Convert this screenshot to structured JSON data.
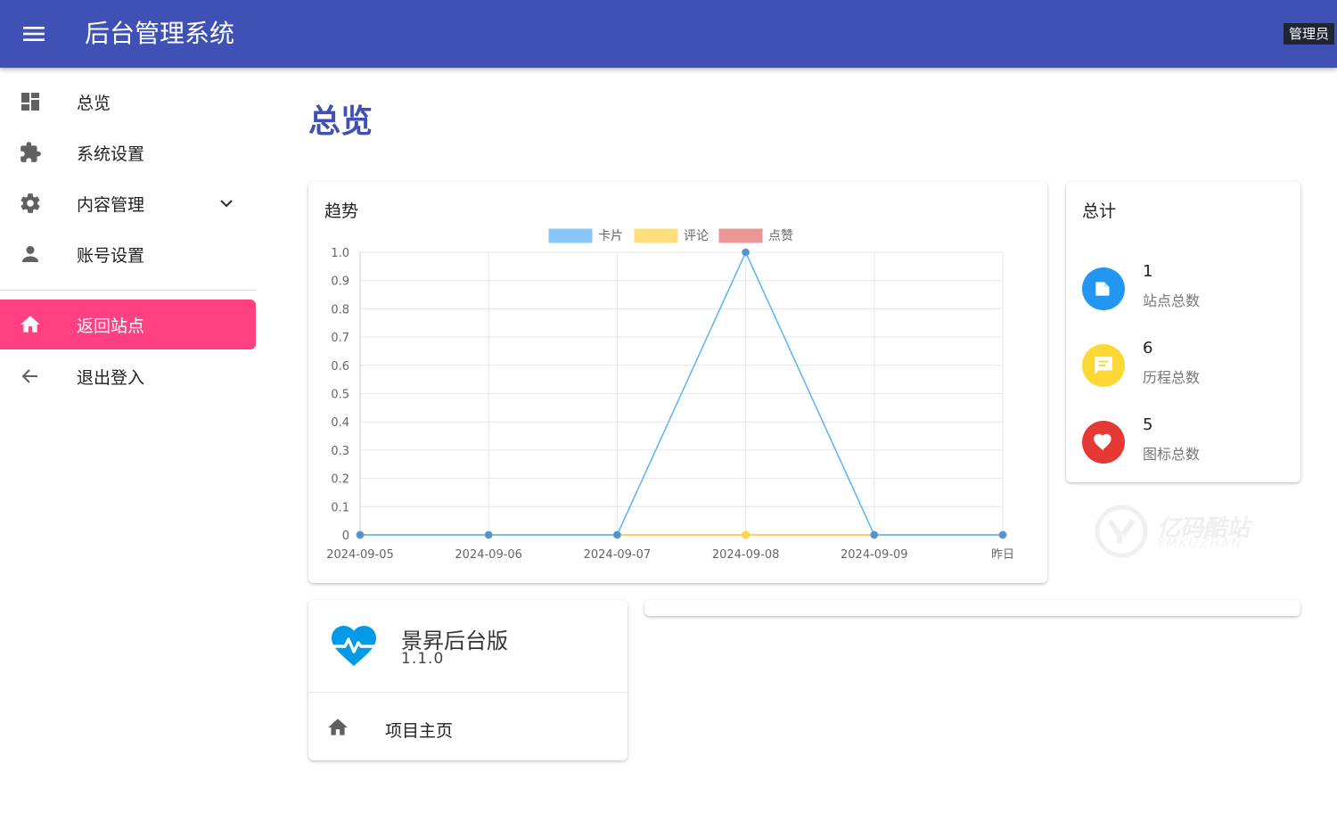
{
  "appbar": {
    "title": "后台管理系统",
    "user": "管理员"
  },
  "sidebar": {
    "items": [
      {
        "label": "总览",
        "icon": "dashboard-icon"
      },
      {
        "label": "系统设置",
        "icon": "puzzle-icon"
      },
      {
        "label": "内容管理",
        "icon": "gear-icon"
      },
      {
        "label": "账号设置",
        "icon": "person-icon"
      },
      {
        "label": "返回站点",
        "icon": "home-icon",
        "active": true
      },
      {
        "label": "退出登入",
        "icon": "arrow-left-icon"
      }
    ]
  },
  "page": {
    "title": "总览"
  },
  "trend": {
    "title": "趋势"
  },
  "chart_data": {
    "type": "line",
    "title": "趋势",
    "categories": [
      "2024-09-05",
      "2024-09-06",
      "2024-09-07",
      "2024-09-08",
      "2024-09-09",
      "昨日"
    ],
    "series": [
      {
        "name": "卡片",
        "values": [
          0,
          0,
          0,
          1,
          0,
          0
        ],
        "color": "#64b5f6"
      },
      {
        "name": "评论",
        "values": [
          0,
          0,
          0,
          0,
          0,
          0
        ],
        "color": "#ffd54f"
      },
      {
        "name": "点赞",
        "values": [
          0,
          0,
          0,
          0,
          0,
          0
        ],
        "color": "#e57373"
      }
    ],
    "ylim": [
      0,
      1
    ],
    "yticks": [
      "0",
      "0.1",
      "0.2",
      "0.3",
      "0.4",
      "0.5",
      "0.6",
      "0.7",
      "0.8",
      "0.9",
      "1.0"
    ],
    "grid": true,
    "legend": "top-center"
  },
  "stats": {
    "title": "总计",
    "items": [
      {
        "value": "1",
        "label": "站点总数",
        "color": "#2196f3",
        "icon": "folder-icon"
      },
      {
        "value": "6",
        "label": "历程总数",
        "color": "#fdd835",
        "icon": "message-icon"
      },
      {
        "value": "5",
        "label": "图标总数",
        "color": "#e53935",
        "icon": "heart-icon"
      }
    ]
  },
  "watermark": {
    "text": "亿码酷站",
    "sub": "YMKUZHAN"
  },
  "about": {
    "name": "景昇后台版",
    "version": "1.1.0",
    "link_label": "项目主页"
  }
}
